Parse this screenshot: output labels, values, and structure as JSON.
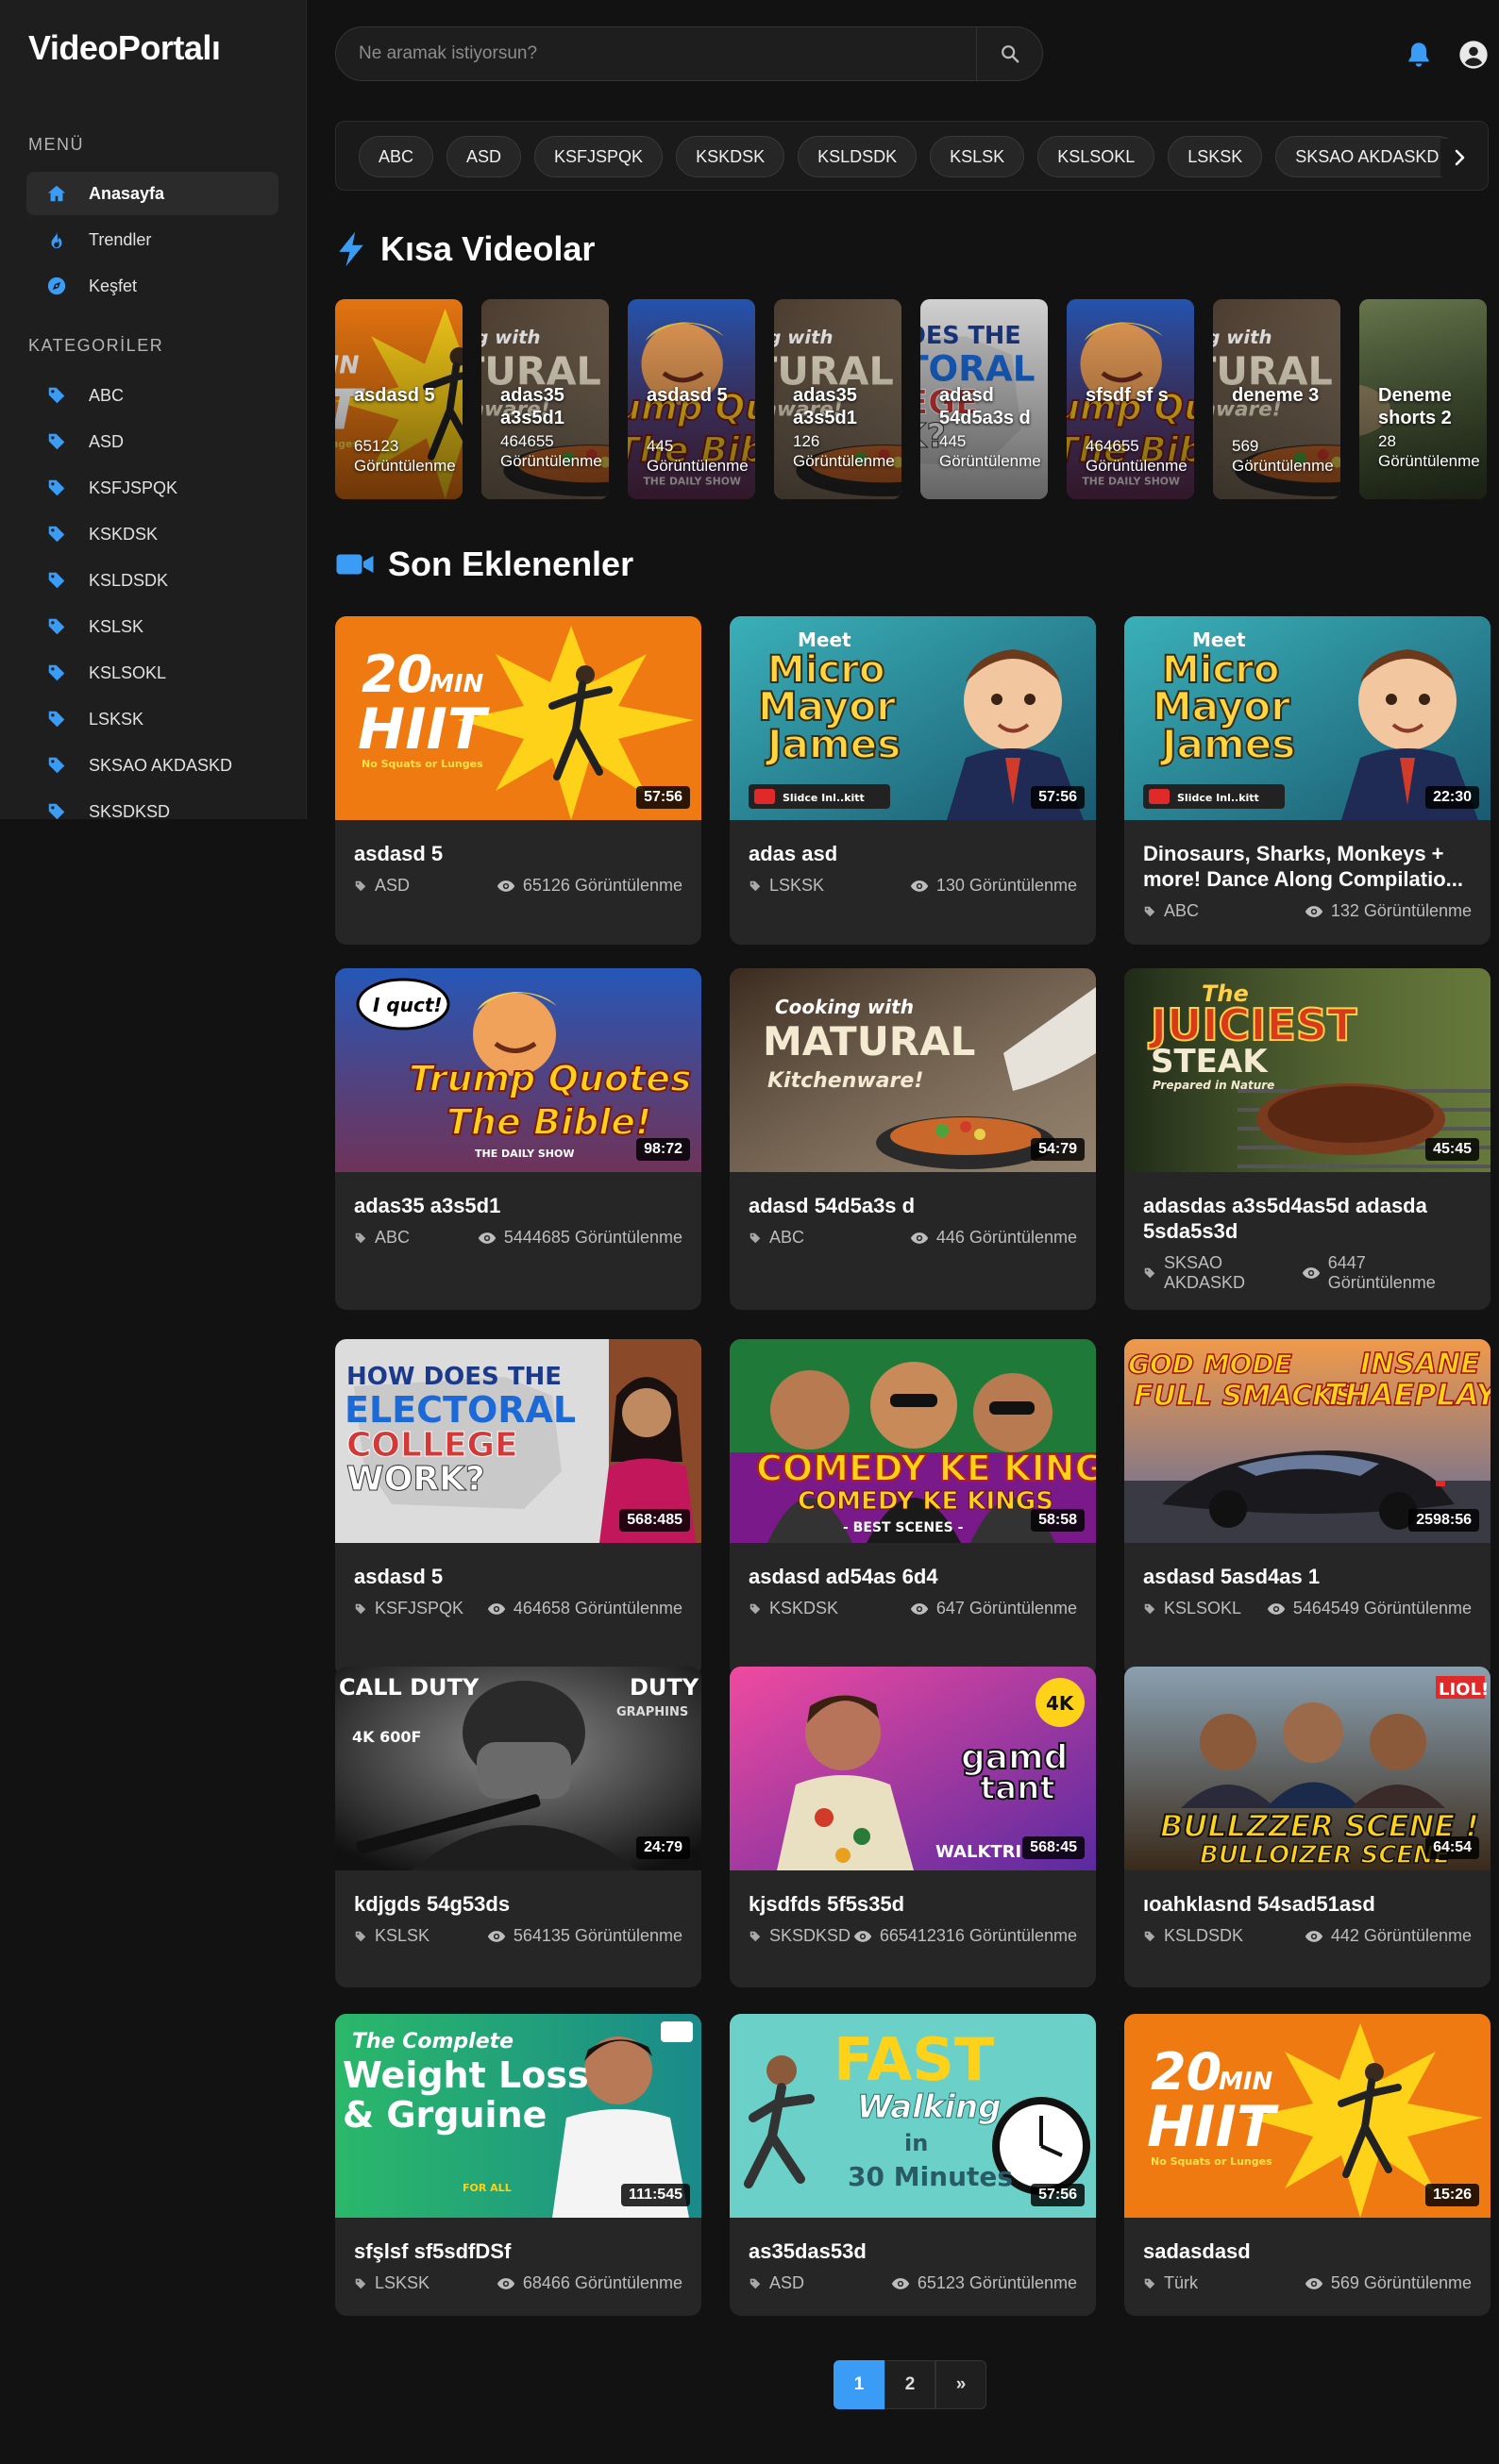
{
  "app": {
    "name": "VideoPortalı"
  },
  "search": {
    "placeholder": "Ne aramak istiyorsun?"
  },
  "sidebar": {
    "menu_title": "MENÜ",
    "menu": [
      {
        "label": "Anasayfa",
        "icon": "home-icon",
        "active": true
      },
      {
        "label": "Trendler",
        "icon": "fire-icon"
      },
      {
        "label": "Keşfet",
        "icon": "compass-icon"
      }
    ],
    "categories_title": "KATEGORİLER",
    "categories": [
      "ABC",
      "ASD",
      "KSFJSPQK",
      "KSKDSK",
      "KSLDSDK",
      "KSLSK",
      "KSLSOKL",
      "LSKSK",
      "SKSAO AKDASKD",
      "SKSDKSD"
    ]
  },
  "chips": [
    "ABC",
    "ASD",
    "KSFJSPQK",
    "KSKDSK",
    "KSLDSDK",
    "KSLSK",
    "KSLSOKL",
    "LSKSK",
    "SKSAO AKDASKD"
  ],
  "shorts_title": "Kısa Videolar",
  "shorts": [
    {
      "title": "asdasd 5",
      "views": "65123 Görüntülenme",
      "theme": "hiit"
    },
    {
      "title": "adas35 a3s5d1",
      "views": "464655 Görüntülenme",
      "theme": "matural"
    },
    {
      "title": "asdasd 5",
      "views": "445 Görüntülenme",
      "theme": "trump"
    },
    {
      "title": "adas35 a3s5d1",
      "views": "126 Görüntülenme",
      "theme": "matural"
    },
    {
      "title": "adasd 54d5a3s d",
      "views": "445 Görüntülenme",
      "theme": "electoral"
    },
    {
      "title": "sfsdf sf s",
      "views": "464655 Görüntülenme",
      "theme": "trump"
    },
    {
      "title": "deneme 3",
      "views": "569 Görüntülenme",
      "theme": "matural"
    },
    {
      "title": "Deneme shorts 2",
      "views": "28 Görüntülenme",
      "theme": "forest"
    }
  ],
  "latest_title": "Son Eklenenler",
  "videos": [
    {
      "title": "asdasd 5",
      "category": "ASD",
      "views": "65126 Görüntülenme",
      "duration": "57:56",
      "theme": "hiit"
    },
    {
      "title": "adas asd",
      "category": "LSKSK",
      "views": "130 Görüntülenme",
      "duration": "57:56",
      "theme": "mayor"
    },
    {
      "title": "Dinosaurs, Sharks, Monkeys + more! Dance Along Compilatio...",
      "category": "ABC",
      "views": "132 Görüntülenme",
      "duration": "22:30",
      "theme": "mayor"
    },
    {
      "title": "adas35 a3s5d1",
      "category": "ABC",
      "views": "5444685 Görüntülenme",
      "duration": "98:72",
      "theme": "trump"
    },
    {
      "title": "adasd 54d5a3s d",
      "category": "ABC",
      "views": "446 Görüntülenme",
      "duration": "54:79",
      "theme": "matural"
    },
    {
      "title": "adasdas a3s5d4as5d adasda 5sda5s3d",
      "category": "SKSAO AKDASKD",
      "views": "6447 Görüntülenme",
      "duration": "45:45",
      "theme": "steak"
    },
    {
      "title": "asdasd 5",
      "category": "KSFJSPQK",
      "views": "464658 Görüntülenme",
      "duration": "568:485",
      "theme": "electoral"
    },
    {
      "title": "asdasd ad54as 6d4",
      "category": "KSKDSK",
      "views": "647 Görüntülenme",
      "duration": "58:58",
      "theme": "comedy"
    },
    {
      "title": "asdasd 5asd4as 1",
      "category": "KSLSOKL",
      "views": "5464549 Görüntülenme",
      "duration": "2598:56",
      "theme": "car"
    },
    {
      "title": "kdjgds 54g53ds",
      "category": "KSLSK",
      "views": "564135 Görüntülenme",
      "duration": "24:79",
      "theme": "duty"
    },
    {
      "title": "kjsdfds 5f5s35d",
      "category": "SKSDKSD",
      "views": "665412316 Görüntülenme",
      "duration": "568:45",
      "theme": "gta"
    },
    {
      "title": "ıoahklasnd 54sad51asd",
      "category": "KSLDSDK",
      "views": "442 Görüntülenme",
      "duration": "64:54",
      "theme": "bulldozer"
    },
    {
      "title": "sfşlsf sf5sdfDSf",
      "category": "LSKSK",
      "views": "68466 Görüntülenme",
      "duration": "111:545",
      "theme": "weightloss"
    },
    {
      "title": "as35das53d",
      "category": "ASD",
      "views": "65123 Görüntülenme",
      "duration": "57:56",
      "theme": "walking"
    },
    {
      "title": "sadasdasd",
      "category": "Türk",
      "views": "569 Görüntülenme",
      "duration": "15:26",
      "theme": "hiit"
    }
  ],
  "thumb_text": {
    "hiit": [
      "20",
      "MIN",
      "HIIT",
      "No Squats or Lunges"
    ],
    "mayor": [
      "Meet",
      "Micro",
      "Mayor",
      "James",
      "Slidce Inl..kitt"
    ],
    "trump": [
      "I quct!",
      "Trump Quotes",
      "The Bible!",
      "THE DAILY SHOW"
    ],
    "matural": [
      "Cooking with",
      "MATURAL",
      "Kitchenware!"
    ],
    "steak": [
      "The",
      "JUICIEST",
      "STEAK",
      "Prepared in Nature"
    ],
    "electoral": [
      "HOW DOES THE",
      "ELECTORAL",
      "COLLEGE",
      "WORK?"
    ],
    "comedy": [
      "COMEDY KE KINGS",
      "COMEDY KE KINGS",
      "- BEST SCENES -"
    ],
    "car": [
      "GOD MODE",
      "FULL SMACKS!",
      "INSANE",
      "THAEPLAY!"
    ],
    "duty": [
      "CALL DUTY",
      "DUTY",
      "GRAPHINS",
      "4K 600F"
    ],
    "gta": [
      "4K",
      "gamd",
      "tant",
      "WALKTRI"
    ],
    "bulldozer": [
      "BULLZZER SCENE !",
      "BULLOIZER SCENE",
      "LIOL!"
    ],
    "weightloss": [
      "The Complete",
      "Weight Loss",
      "& Grguine",
      "FOR ALL"
    ],
    "walking": [
      "FAST",
      "Walking",
      "in",
      "30 Minutes"
    ],
    "forest": []
  },
  "pagination": {
    "pages": [
      "1",
      "2"
    ],
    "next": "»",
    "current": "1"
  },
  "colors": {
    "accent": "#3b9cf5",
    "background": "#121212",
    "sidebar": "#1e1e1e",
    "card": "#262626"
  }
}
